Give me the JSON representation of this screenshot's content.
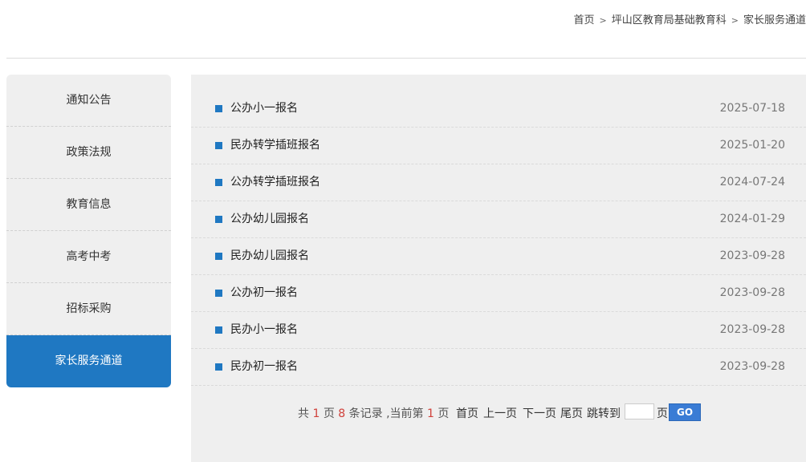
{
  "breadcrumb": [
    {
      "label": "首页"
    },
    {
      "label": "坪山区教育局基础教育科"
    },
    {
      "label": "家长服务通道"
    }
  ],
  "sidebar": {
    "items": [
      {
        "label": "通知公告",
        "active": false
      },
      {
        "label": "政策法规",
        "active": false
      },
      {
        "label": "教育信息",
        "active": false
      },
      {
        "label": "高考中考",
        "active": false
      },
      {
        "label": "招标采购",
        "active": false
      },
      {
        "label": "家长服务通道",
        "active": true
      }
    ]
  },
  "list": {
    "rows": [
      {
        "title": "公办小一报名",
        "date": "2025-07-18"
      },
      {
        "title": "民办转学插班报名",
        "date": "2025-01-20"
      },
      {
        "title": "公办转学插班报名",
        "date": "2024-07-24"
      },
      {
        "title": "公办幼儿园报名",
        "date": "2024-01-29"
      },
      {
        "title": "民办幼儿园报名",
        "date": "2023-09-28"
      },
      {
        "title": "公办初一报名",
        "date": "2023-09-28"
      },
      {
        "title": "民办小一报名",
        "date": "2023-09-28"
      },
      {
        "title": "民办初一报名",
        "date": "2023-09-28"
      }
    ]
  },
  "pagination": {
    "total_prefix": "共",
    "total_pages": "1",
    "pages_word": "页",
    "total_records": "8",
    "records_word": "条记录 ,当前第",
    "current_page": "1",
    "current_suffix": "页",
    "first": "首页",
    "prev": "上一页",
    "next": "下一页",
    "last": "尾页",
    "jump_label": "跳转到",
    "page_input_value": "",
    "page_unit": "页",
    "go_label": "GO"
  },
  "colors": {
    "accent": "#1f78c2",
    "highlight_number": "#d0413b",
    "panel_bg": "#efefef"
  }
}
